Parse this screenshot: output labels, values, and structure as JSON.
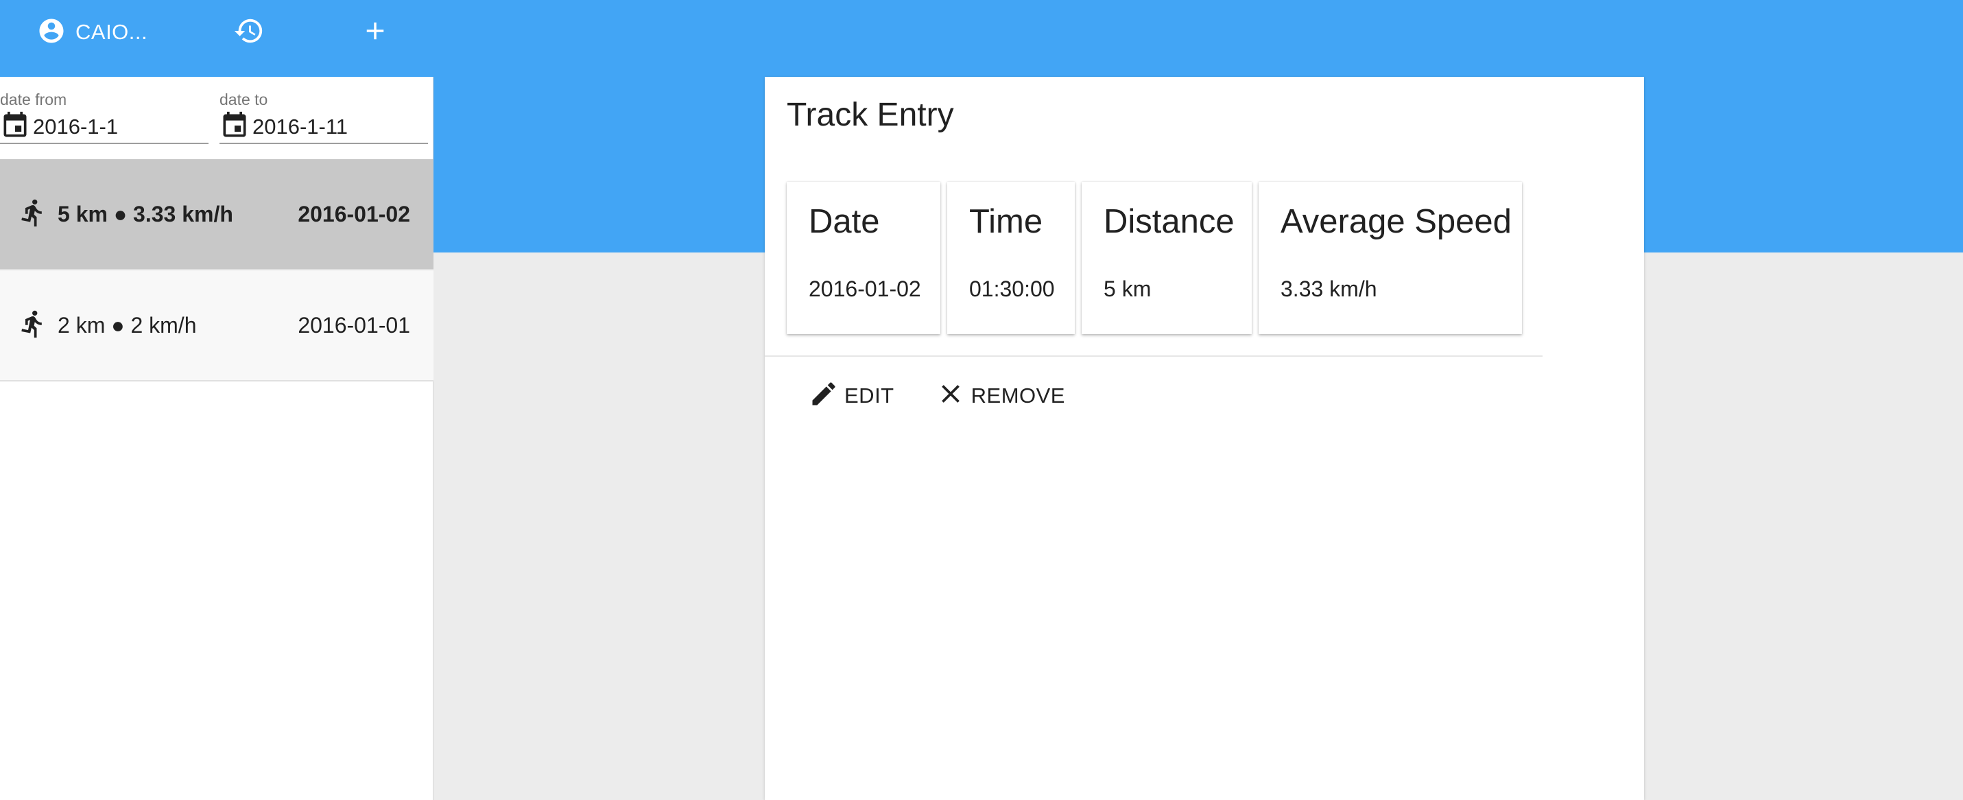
{
  "colors": {
    "app_bar": "#42a5f5",
    "background": "#ececec",
    "selected_row": "#c8c8c8"
  },
  "toolbar": {
    "user_label": "CAIO...",
    "user_icon": "account-circle-icon",
    "history_icon": "history-icon",
    "add_icon": "plus-icon"
  },
  "filters": {
    "date_from": {
      "caption": "date from",
      "value": "2016-1-1",
      "icon": "calendar-icon"
    },
    "date_to": {
      "caption": "date to",
      "value": "2016-1-11",
      "icon": "calendar-icon"
    }
  },
  "tracks": [
    {
      "summary": "5 km ● 3.33 km/h",
      "date": "2016-01-02",
      "selected": true,
      "icon": "run-icon"
    },
    {
      "summary": "2 km ● 2 km/h",
      "date": "2016-01-01",
      "selected": false,
      "icon": "run-icon"
    }
  ],
  "detail": {
    "title": "Track Entry",
    "stats": {
      "date": {
        "label": "Date",
        "value": "2016-01-02"
      },
      "time": {
        "label": "Time",
        "value": "01:30:00"
      },
      "distance": {
        "label": "Distance",
        "value": "5 km"
      },
      "speed": {
        "label": "Average Speed",
        "value": "3.33 km/h"
      }
    },
    "actions": {
      "edit_label": "EDIT",
      "remove_label": "REMOVE"
    }
  }
}
